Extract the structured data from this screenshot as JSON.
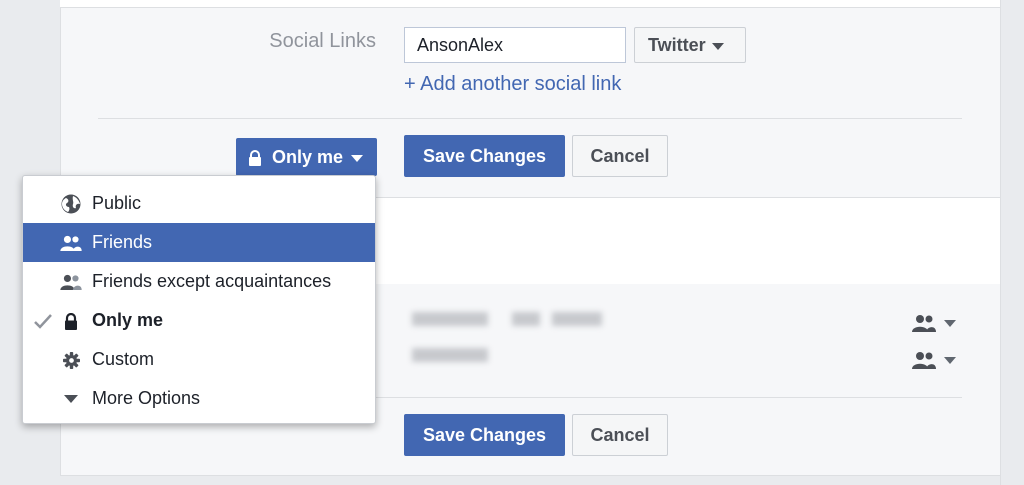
{
  "social": {
    "label": "Social Links",
    "handle_value": "AnsonAlex",
    "network_select": "Twitter",
    "add_link": "+ Add another social link"
  },
  "privacy_button": {
    "label": "Only me"
  },
  "actions_top": {
    "save": "Save Changes",
    "cancel": "Cancel"
  },
  "actions_bottom": {
    "save": "Save Changes",
    "cancel": "Cancel"
  },
  "audience_menu": {
    "items": [
      {
        "label": "Public",
        "icon": "globe-icon"
      },
      {
        "label": "Friends",
        "icon": "friends-icon",
        "highlighted": true
      },
      {
        "label": "Friends except acquaintances",
        "icon": "friends-except-icon"
      },
      {
        "label": "Only me",
        "icon": "lock-icon",
        "checked": true
      },
      {
        "label": "Custom",
        "icon": "gear-icon"
      },
      {
        "label": "More Options",
        "icon": "caret-down-icon"
      }
    ]
  },
  "colors": {
    "brand_blue": "#4267b2",
    "panel_bg": "#f6f7f9",
    "page_bg": "#e9ebee",
    "muted_text": "#90949c"
  }
}
